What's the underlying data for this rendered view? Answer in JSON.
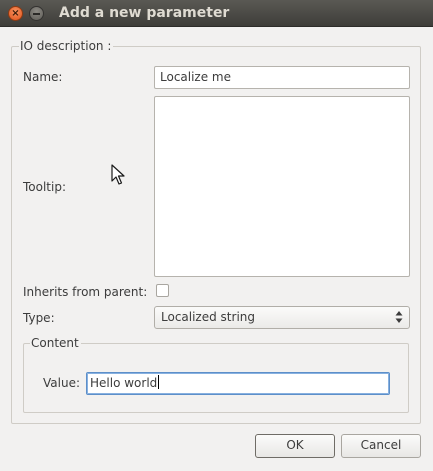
{
  "window": {
    "title": "Add a new parameter",
    "close_symbol": "×",
    "close_icon": "close-icon",
    "minimize_icon": "minimize-icon"
  },
  "io_group": {
    "legend": "IO description :"
  },
  "form": {
    "name_label": "Name:",
    "name_value": "Localize me",
    "tooltip_label": "Tooltip:",
    "tooltip_value": "",
    "inherits_label": "Inherits from parent:",
    "inherits_checked": false,
    "type_label": "Type:",
    "type_value": "Localized string",
    "type_arrow_icon": "up-down-arrows-icon"
  },
  "content_group": {
    "legend": "Content",
    "value_label": "Value:",
    "value_value": "Hello world"
  },
  "buttons": {
    "ok_label": "OK",
    "cancel_label": "Cancel"
  },
  "cursor_icon": "mouse-pointer-icon"
}
